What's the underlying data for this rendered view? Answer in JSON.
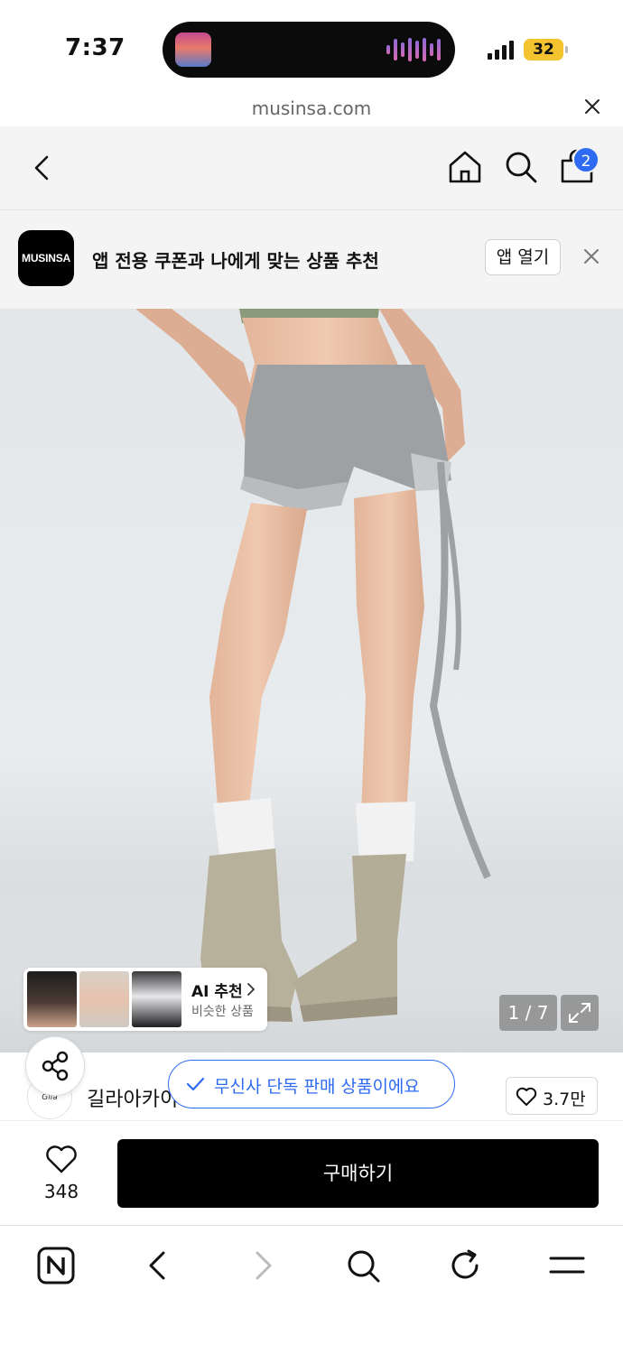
{
  "status_bar": {
    "time": "7:37",
    "battery": "32"
  },
  "url_bar": {
    "domain": "musinsa.com"
  },
  "cart": {
    "badge_count": "2"
  },
  "app_banner": {
    "logo_text": "MUSINSA",
    "message": "앱 전용 쿠폰과 나에게 맞는 상품 추천",
    "open_button": "앱 열기"
  },
  "gallery": {
    "counter": "1 / 7",
    "ai_recommend": {
      "title": "AI 추천",
      "subtitle": "비슷한 상품"
    }
  },
  "brand": {
    "name": "길라아카이",
    "logo_text": "Gila"
  },
  "exclusive_badge": "무신사 단독 판매 상품이에요",
  "brand_likes": "3.7만",
  "purchase": {
    "wish_count": "348",
    "buy_label": "구매하기"
  },
  "colors": {
    "accent": "#2f6bf2",
    "buy_button": "#000000",
    "battery": "#f4c430"
  }
}
